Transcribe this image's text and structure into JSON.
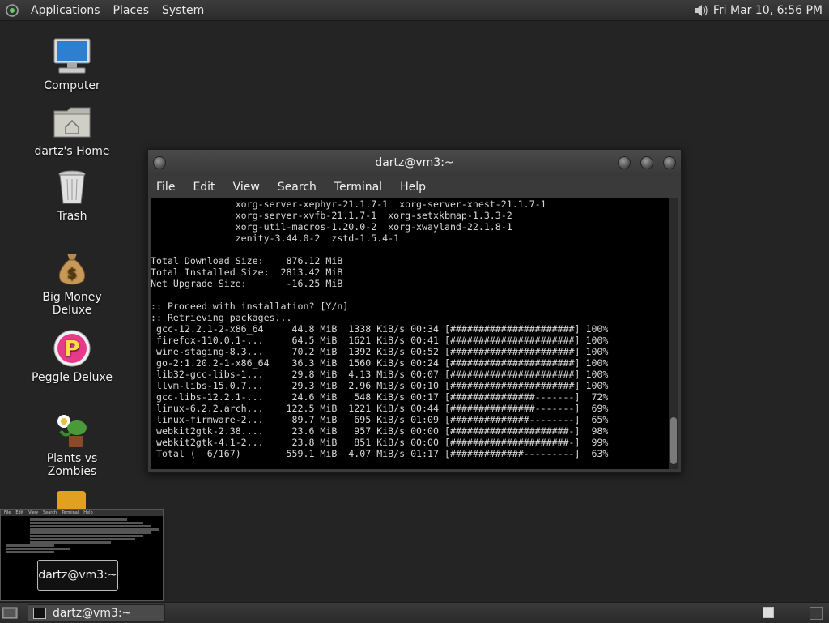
{
  "top_panel": {
    "menus": [
      "Applications",
      "Places",
      "System"
    ],
    "clock": "Fri Mar 10,  6:56 PM"
  },
  "desktop_icons": [
    {
      "label": "Computer",
      "icon": "computer-icon"
    },
    {
      "label": "dartz's Home",
      "icon": "home-folder-icon"
    },
    {
      "label": "Trash",
      "icon": "trash-icon"
    },
    {
      "label": "Big Money Deluxe",
      "icon": "money-bag-icon"
    },
    {
      "label": "Peggle Deluxe",
      "icon": "peggle-icon"
    },
    {
      "label": "Plants vs Zombies",
      "icon": "plants-vs-zombies-icon"
    }
  ],
  "terminal": {
    "title": "dartz@vm3:~",
    "menu": [
      "File",
      "Edit",
      "View",
      "Search",
      "Terminal",
      "Help"
    ],
    "lines": [
      "               xorg-server-xephyr-21.1.7-1  xorg-server-xnest-21.1.7-1",
      "               xorg-server-xvfb-21.1.7-1  xorg-setxkbmap-1.3.3-2",
      "               xorg-util-macros-1.20.0-2  xorg-xwayland-22.1.8-1",
      "               zenity-3.44.0-2  zstd-1.5.4-1",
      "",
      "Total Download Size:    876.12 MiB",
      "Total Installed Size:  2813.42 MiB",
      "Net Upgrade Size:       -16.25 MiB",
      "",
      ":: Proceed with installation? [Y/n]",
      ":: Retrieving packages...",
      " gcc-12.2.1-2-x86_64     44.8 MiB  1338 KiB/s 00:34 [######################] 100%",
      " firefox-110.0.1-...     64.5 MiB  1621 KiB/s 00:41 [######################] 100%",
      " wine-staging-8.3...     70.2 MiB  1392 KiB/s 00:52 [######################] 100%",
      " go-2:1.20.2-1-x86_64    36.3 MiB  1560 KiB/s 00:24 [######################] 100%",
      " lib32-gcc-libs-1...     29.8 MiB  4.13 MiB/s 00:07 [######################] 100%",
      " llvm-libs-15.0.7...     29.3 MiB  2.96 MiB/s 00:10 [######################] 100%",
      " gcc-libs-12.2.1-...     24.6 MiB   548 KiB/s 00:17 [###############-------]  72%",
      " linux-6.2.2.arch...    122.5 MiB  1221 KiB/s 00:44 [###############-------]  69%",
      " linux-firmware-2...     89.7 MiB   695 KiB/s 01:09 [##############--------]  65%",
      " webkit2gtk-2.38....     23.6 MiB   957 KiB/s 00:00 [#####################-]  98%",
      " webkit2gtk-4.1-2...     23.8 MiB   851 KiB/s 00:00 [#####################-]  99%",
      " Total (  6/167)        559.1 MiB  4.07 MiB/s 01:17 [#############---------]  63%"
    ]
  },
  "preview_tooltip": "dartz@vm3:~",
  "preview_menu": [
    "File",
    "Edit",
    "View",
    "Search",
    "Terminal",
    "Help"
  ],
  "taskbar": {
    "task_label": "dartz@vm3:~"
  }
}
